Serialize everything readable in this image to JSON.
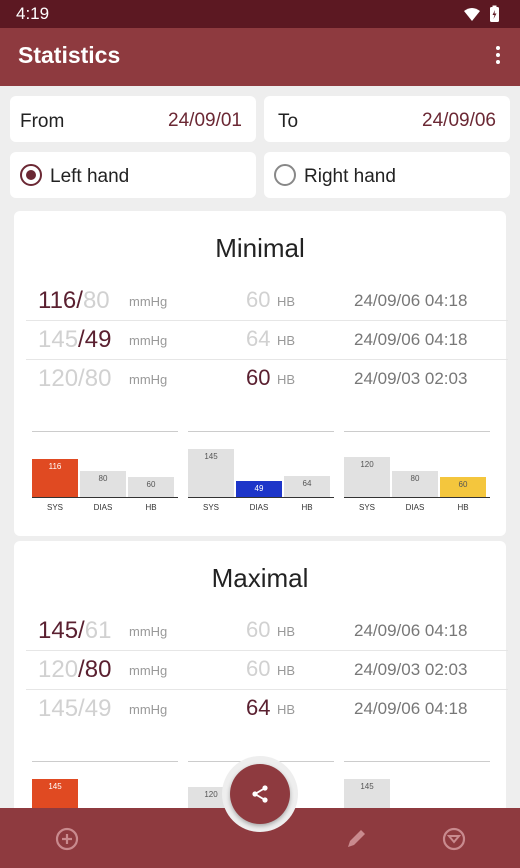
{
  "status": {
    "time": "4:19"
  },
  "appbar": {
    "title": "Statistics"
  },
  "range": {
    "from_label": "From",
    "from_value": "24/09/01",
    "to_label": "To",
    "to_value": "24/09/06"
  },
  "hand": {
    "left": "Left hand",
    "right": "Right hand",
    "selected": "left"
  },
  "minimal": {
    "title": "Minimal",
    "rows": [
      {
        "sys": "116",
        "dias": "80",
        "unit": "mmHg",
        "hb": "60",
        "hb_unit": "HB",
        "date": "24/09/06 04:18"
      },
      {
        "sys": "145",
        "dias": "49",
        "unit": "mmHg",
        "hb": "64",
        "hb_unit": "HB",
        "date": "24/09/06 04:18"
      },
      {
        "sys": "120",
        "dias": "80",
        "unit": "mmHg",
        "hb": "60",
        "hb_unit": "HB",
        "date": "24/09/03 02:03"
      }
    ],
    "charts": [
      {
        "sys": 116,
        "dias": 80,
        "hb": 60,
        "highlight": "sys"
      },
      {
        "sys": 145,
        "dias": 49,
        "hb": 64,
        "highlight": "dias"
      },
      {
        "sys": 120,
        "dias": 80,
        "hb": 60,
        "highlight": "hb"
      }
    ]
  },
  "maximal": {
    "title": "Maximal",
    "rows": [
      {
        "sys": "145",
        "dias": "61",
        "unit": "mmHg",
        "hb": "60",
        "hb_unit": "HB",
        "date": "24/09/06 04:18"
      },
      {
        "sys": "120",
        "dias": "80",
        "unit": "mmHg",
        "hb": "60",
        "hb_unit": "HB",
        "date": "24/09/03 02:03"
      },
      {
        "sys": "145",
        "dias": "49",
        "unit": "mmHg",
        "hb": "64",
        "hb_unit": "HB",
        "date": "24/09/06 04:18"
      }
    ],
    "charts": [
      {
        "sys": 145,
        "highlight": "sys"
      },
      {
        "sys": 120,
        "highlight": "none"
      },
      {
        "sys": 145,
        "highlight": "none"
      }
    ]
  },
  "chart_labels": {
    "sys": "SYS",
    "dias": "DIAS",
    "hb": "HB"
  },
  "colors": {
    "accent": "#8e3a3f",
    "highlight_sys": "#e04a22",
    "highlight_dias": "#1d35c9",
    "highlight_hb": "#f4c63d",
    "bar_neutral": "#e1e1e1"
  }
}
